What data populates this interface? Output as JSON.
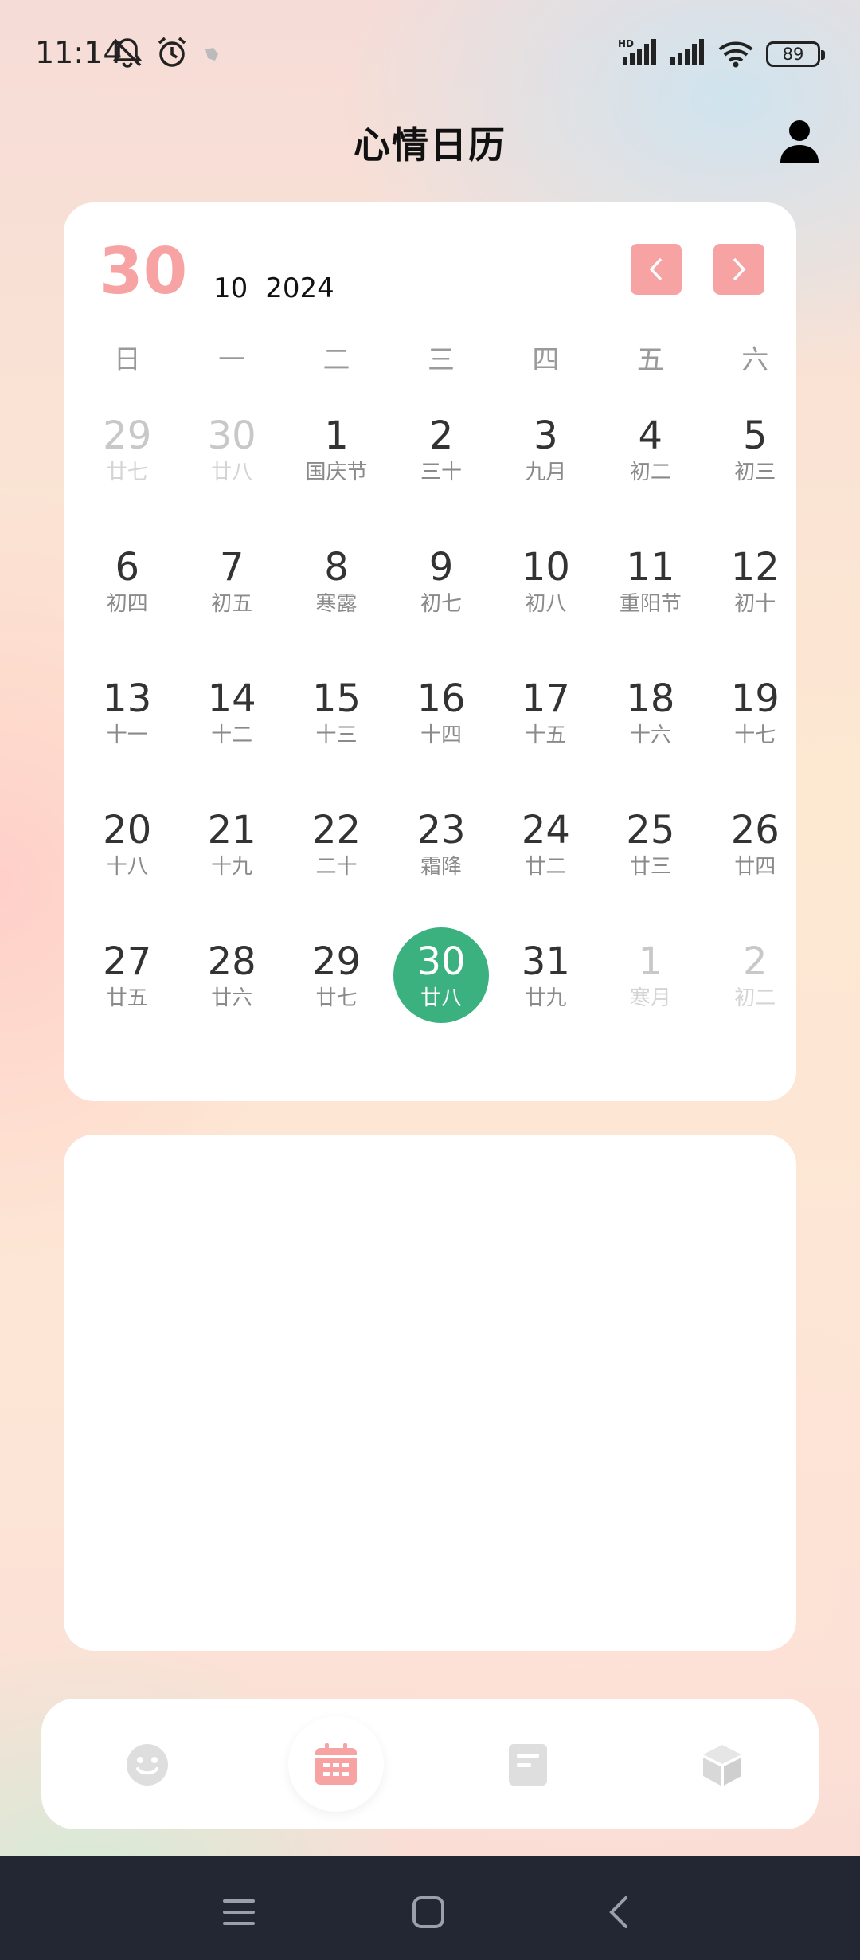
{
  "status_bar": {
    "time": "11:14",
    "battery": "89"
  },
  "header": {
    "title": "心情日历"
  },
  "calendar": {
    "selected_day": "30",
    "month": "10",
    "year": "2024",
    "weekdays": [
      "日",
      "一",
      "二",
      "三",
      "四",
      "五",
      "六"
    ],
    "weeks": [
      [
        {
          "day": "29",
          "lunar": "廿七",
          "other": true
        },
        {
          "day": "30",
          "lunar": "廿八",
          "other": true
        },
        {
          "day": "1",
          "lunar": "国庆节"
        },
        {
          "day": "2",
          "lunar": "三十"
        },
        {
          "day": "3",
          "lunar": "九月"
        },
        {
          "day": "4",
          "lunar": "初二"
        },
        {
          "day": "5",
          "lunar": "初三"
        }
      ],
      [
        {
          "day": "6",
          "lunar": "初四"
        },
        {
          "day": "7",
          "lunar": "初五"
        },
        {
          "day": "8",
          "lunar": "寒露"
        },
        {
          "day": "9",
          "lunar": "初七"
        },
        {
          "day": "10",
          "lunar": "初八"
        },
        {
          "day": "11",
          "lunar": "重阳节"
        },
        {
          "day": "12",
          "lunar": "初十"
        }
      ],
      [
        {
          "day": "13",
          "lunar": "十一"
        },
        {
          "day": "14",
          "lunar": "十二"
        },
        {
          "day": "15",
          "lunar": "十三"
        },
        {
          "day": "16",
          "lunar": "十四"
        },
        {
          "day": "17",
          "lunar": "十五"
        },
        {
          "day": "18",
          "lunar": "十六"
        },
        {
          "day": "19",
          "lunar": "十七"
        }
      ],
      [
        {
          "day": "20",
          "lunar": "十八"
        },
        {
          "day": "21",
          "lunar": "十九"
        },
        {
          "day": "22",
          "lunar": "二十"
        },
        {
          "day": "23",
          "lunar": "霜降"
        },
        {
          "day": "24",
          "lunar": "廿二"
        },
        {
          "day": "25",
          "lunar": "廿三"
        },
        {
          "day": "26",
          "lunar": "廿四"
        }
      ],
      [
        {
          "day": "27",
          "lunar": "廿五"
        },
        {
          "day": "28",
          "lunar": "廿六"
        },
        {
          "day": "29",
          "lunar": "廿七"
        },
        {
          "day": "30",
          "lunar": "廿八",
          "today": true
        },
        {
          "day": "31",
          "lunar": "廿九"
        },
        {
          "day": "1",
          "lunar": "寒月",
          "other": true
        },
        {
          "day": "2",
          "lunar": "初二",
          "other": true
        }
      ]
    ]
  },
  "tabs": [
    {
      "icon": "smiley-icon"
    },
    {
      "icon": "calendar-icon",
      "active": true
    },
    {
      "icon": "notes-icon"
    },
    {
      "icon": "cube-icon"
    }
  ],
  "colors": {
    "accent_pink": "#f8a3a3",
    "selected_green": "#3bb180",
    "nav_bar": "#232733"
  }
}
